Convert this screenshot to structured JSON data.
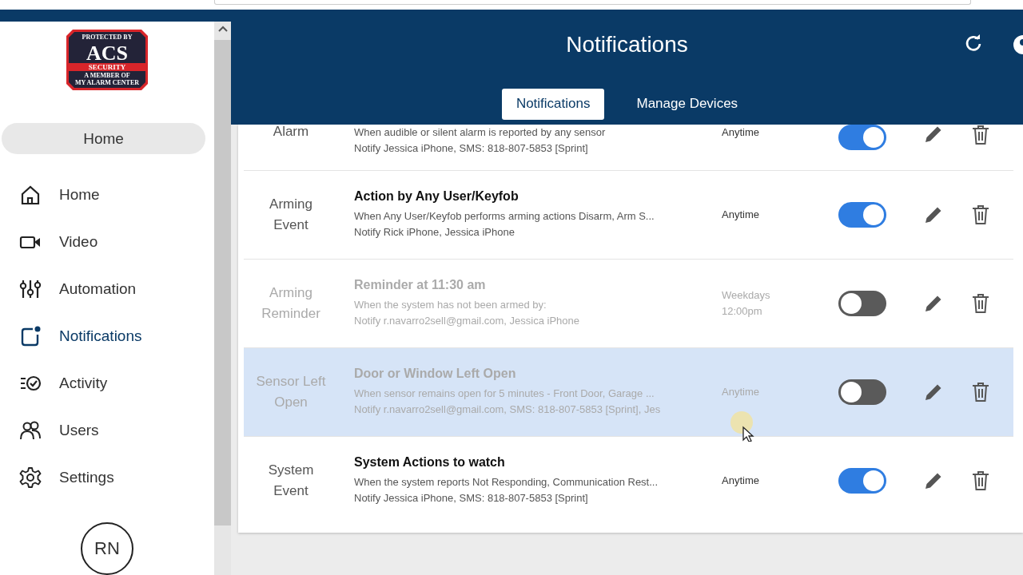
{
  "logo": {
    "top": "PROTECTED BY",
    "name": "ACS",
    "sub": "SECURITY",
    "member_1": "A MEMBER OF",
    "member_2": "MY ALARM CENTER"
  },
  "sidebar": {
    "home_button": "Home",
    "items": [
      {
        "label": "Home",
        "kind": "home",
        "selected": false
      },
      {
        "label": "Video",
        "kind": "video",
        "selected": false
      },
      {
        "label": "Automation",
        "kind": "automation",
        "selected": false
      },
      {
        "label": "Notifications",
        "kind": "notifications",
        "selected": true
      },
      {
        "label": "Activity",
        "kind": "activity",
        "selected": false
      },
      {
        "label": "Users",
        "kind": "users",
        "selected": false
      },
      {
        "label": "Settings",
        "kind": "settings",
        "selected": false
      }
    ],
    "avatar": "RN"
  },
  "header": {
    "title": "Notifications",
    "tabs": [
      {
        "label": "Notifications",
        "selected": true
      },
      {
        "label": "Manage Devices",
        "selected": false
      }
    ]
  },
  "rules": [
    {
      "category": "Alarm",
      "description": "When audible or silent alarm is reported by any sensor",
      "notify": "Notify Jessica iPhone, SMS: 818-807-5853 [Sprint]",
      "schedule": "Anytime",
      "on": true,
      "selected": false
    },
    {
      "category": "Arming Event",
      "title": "Action by Any User/Keyfob",
      "description": "When Any User/Keyfob performs arming actions Disarm, Arm S...",
      "notify": "Notify Rick iPhone, Jessica iPhone",
      "schedule": "Anytime",
      "on": true,
      "selected": false
    },
    {
      "category": "Arming Reminder",
      "title": "Reminder at 11:30 am",
      "description": "When the system has not been armed by:",
      "notify": "Notify r.navarro2sell@gmail.com, Jessica iPhone",
      "schedule": "Weekdays 12:00pm",
      "on": false,
      "selected": false
    },
    {
      "category": "Sensor Left Open",
      "title": "Door or Window Left Open",
      "description": "When sensor remains open for 5 minutes - Front Door, Garage ...",
      "notify": "Notify r.navarro2sell@gmail.com, SMS: 818-807-5853 [Sprint], Jes",
      "schedule": "Anytime",
      "on": false,
      "selected": true
    },
    {
      "category": "System Event",
      "title": "System Actions to watch",
      "description": "When the system reports Not Responding, Communication Rest...",
      "notify": "Notify Jessica iPhone, SMS: 818-807-5853 [Sprint]",
      "schedule": "Anytime",
      "on": true,
      "selected": false
    }
  ]
}
